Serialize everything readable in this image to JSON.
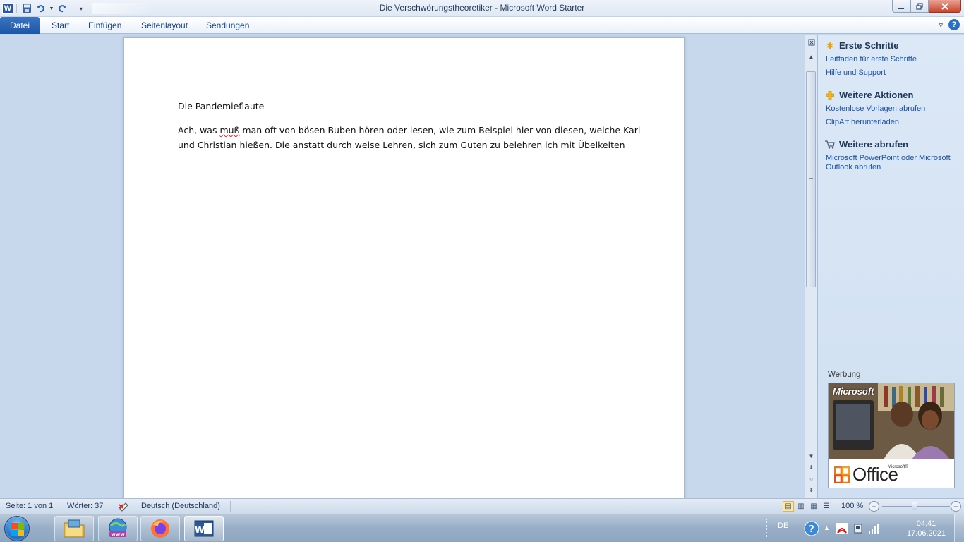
{
  "window": {
    "title": "Die Verschwörungstheoretiker  -  Microsoft Word Starter"
  },
  "ribbon": {
    "tabs": [
      "Datei",
      "Start",
      "Einfügen",
      "Seitenlayout",
      "Sendungen"
    ]
  },
  "document": {
    "title": "Die Pandemieflaute",
    "paragraph_before_spell": "Ach, was ",
    "misspelled_word": "muß",
    "paragraph_after_spell": " man oft von bösen Buben hören oder lesen, wie zum Beispiel hier von diesen, welche Karl und Christian  hießen. Die anstatt durch weise Lehren, sich zum Guten zu belehren ich mit Übelkeiten"
  },
  "taskpane": {
    "sections": [
      {
        "heading": "Erste Schritte",
        "icon": "sparkle-icon",
        "links": [
          "Leitfaden für erste Schritte",
          "Hilfe und Support"
        ]
      },
      {
        "heading": "Weitere Aktionen",
        "icon": "plus-icon",
        "links": [
          "Kostenlose Vorlagen abrufen",
          "ClipArt herunterladen"
        ]
      },
      {
        "heading": "Weitere abrufen",
        "icon": "cart-icon",
        "links": [
          "Microsoft PowerPoint oder Microsoft Outlook abrufen"
        ]
      }
    ],
    "ad_label": "Werbung",
    "ad_brand_top": "Microsoft",
    "ad_brand_bottom": "Office",
    "ad_brand_sup": "Microsoft®"
  },
  "statusbar": {
    "page": "Seite: 1 von 1",
    "words": "Wörter: 37",
    "language": "Deutsch (Deutschland)",
    "zoom": "100 %",
    "zoom_level_percent": 100
  },
  "taskbar": {
    "apps": [
      "windows-explorer-icon",
      "internet-icon",
      "firefox-icon",
      "word-icon"
    ],
    "active_app": "word-icon",
    "language": "DE",
    "time": "04:41",
    "date": "17.06.2021"
  },
  "colors": {
    "accent": "#1b56a8",
    "link": "#1a54a8",
    "spellcheck": "#dd2222"
  }
}
